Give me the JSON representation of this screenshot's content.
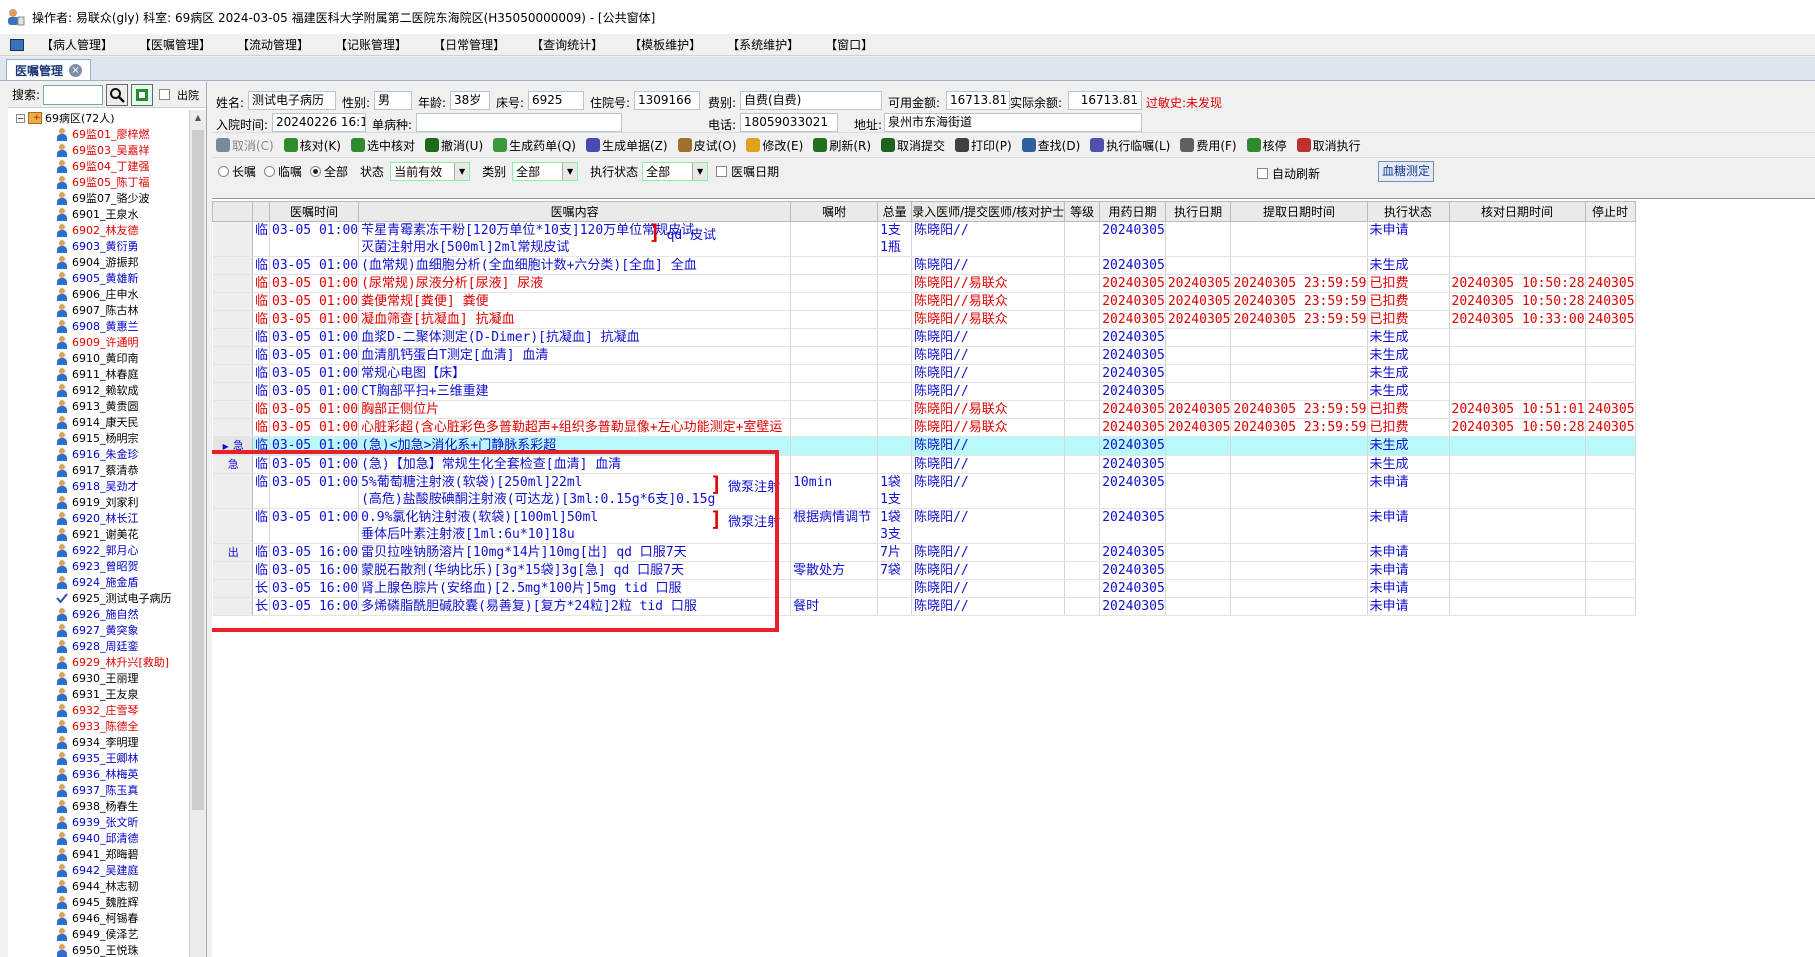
{
  "title_bar": {
    "text": "操作者: 易联众(gly)  科室: 69病区  2024-03-05  福建医科大学附属第二医院东海院区(H35050000009) - [公共窗体]"
  },
  "menu": [
    "【病人管理】",
    "【医嘱管理】",
    "【流动管理】",
    "【记账管理】",
    "【日常管理】",
    "【查询统计】",
    "【模板维护】",
    "【系统维护】",
    "【窗口】"
  ],
  "active_tab": "医嘱管理",
  "left_panel": {
    "search_label": "搜索:",
    "search_value": "",
    "discharge_label": "出院",
    "root": "69病区(72人)",
    "patients": [
      {
        "label": "69监01_廖梓燃",
        "color": "red"
      },
      {
        "label": "69监03_吴嘉祥",
        "color": "red"
      },
      {
        "label": "69监04_丁建强",
        "color": "red"
      },
      {
        "label": "69监05_陈丁福",
        "color": "red"
      },
      {
        "label": "69监07_骆少波",
        "color": "black"
      },
      {
        "label": "6901_王泉水",
        "color": "black"
      },
      {
        "label": "6902_林友德",
        "color": "red"
      },
      {
        "label": "6903_黄衍勇",
        "color": "blue"
      },
      {
        "label": "6904_游振邦",
        "color": "black"
      },
      {
        "label": "6905_黄雄新",
        "color": "blue"
      },
      {
        "label": "6906_庄申水",
        "color": "black"
      },
      {
        "label": "6907_陈古林",
        "color": "black"
      },
      {
        "label": "6908_黄惠兰",
        "color": "blue"
      },
      {
        "label": "6909_许通明",
        "color": "red"
      },
      {
        "label": "6910_黄印南",
        "color": "black"
      },
      {
        "label": "6911_林春庭",
        "color": "black"
      },
      {
        "label": "6912_赖软成",
        "color": "black"
      },
      {
        "label": "6913_黄贵圆",
        "color": "black"
      },
      {
        "label": "6914_康天民",
        "color": "black"
      },
      {
        "label": "6915_杨明宗",
        "color": "black"
      },
      {
        "label": "6916_朱金珍",
        "color": "blue"
      },
      {
        "label": "6917_蔡清恭",
        "color": "black"
      },
      {
        "label": "6918_吴劲才",
        "color": "blue"
      },
      {
        "label": "6919_刘家利",
        "color": "black"
      },
      {
        "label": "6920_林长江",
        "color": "blue"
      },
      {
        "label": "6921_谢美花",
        "color": "black"
      },
      {
        "label": "6922_郭月心",
        "color": "blue"
      },
      {
        "label": "6923_曾昭贺",
        "color": "blue"
      },
      {
        "label": "6924_施金盾",
        "color": "blue"
      },
      {
        "label": "6925_测试电子病历",
        "color": "black",
        "checked": true
      },
      {
        "label": "6926_施自然",
        "color": "blue"
      },
      {
        "label": "6927_黄突象",
        "color": "blue"
      },
      {
        "label": "6928_周廷銮",
        "color": "blue"
      },
      {
        "label": "6929_林升兴[救助]",
        "color": "red"
      },
      {
        "label": "6930_王丽理",
        "color": "black"
      },
      {
        "label": "6931_王友泉",
        "color": "black"
      },
      {
        "label": "6932_庄雪琴",
        "color": "red"
      },
      {
        "label": "6933_陈德全",
        "color": "red"
      },
      {
        "label": "6934_李明理",
        "color": "black"
      },
      {
        "label": "6935_王卿林",
        "color": "blue"
      },
      {
        "label": "6936_林梅英",
        "color": "blue"
      },
      {
        "label": "6937_陈玉真",
        "color": "blue"
      },
      {
        "label": "6938_杨春生",
        "color": "black"
      },
      {
        "label": "6939_张文昕",
        "color": "blue"
      },
      {
        "label": "6940_邱清德",
        "color": "blue"
      },
      {
        "label": "6941_郑晦碧",
        "color": "black"
      },
      {
        "label": "6942_吴建庭",
        "color": "blue"
      },
      {
        "label": "6944_林志韧",
        "color": "black"
      },
      {
        "label": "6945_魏胜辉",
        "color": "black"
      },
      {
        "label": "6946_柯锡春",
        "color": "black"
      },
      {
        "label": "6949_侯泽艺",
        "color": "black"
      },
      {
        "label": "6950_王悦珠",
        "color": "black"
      }
    ]
  },
  "patient_info": {
    "name_label": "姓名:",
    "name": "测试电子病历",
    "sex_label": "性别:",
    "sex": "男",
    "age_label": "年龄:",
    "age": "38岁",
    "bed_label": "床号:",
    "bed": "6925",
    "inpatient_label": "住院号:",
    "inpatient_no": "1309166",
    "category_label": "费别:",
    "category": "自费(自费)",
    "available_label": "可用金额:",
    "available": "16713.81",
    "balance_label": "实际余额:",
    "balance": "16713.81",
    "allergy": "过敏史:未发现",
    "admit_label": "入院时间:",
    "admit_time": "20240226 16:11:49",
    "disease_label": "单病种:",
    "disease": "",
    "phone_label": "电话:",
    "phone": "18059033021",
    "address_label": "地址:",
    "address": "泉州市东海街道"
  },
  "toolbar": [
    {
      "label": "取消(C)",
      "disabled": true,
      "color": "#7a8a9a"
    },
    {
      "label": "核对(K)",
      "disabled": false,
      "color": "#2e8b2e"
    },
    {
      "label": "选中核对",
      "disabled": false,
      "color": "#2e8b2e"
    },
    {
      "label": "撤消(U)",
      "disabled": false,
      "color": "#1a6a1a"
    },
    {
      "label": "生成药单(Q)",
      "disabled": false,
      "color": "#3a9a3a"
    },
    {
      "label": "生成单据(Z)",
      "disabled": false,
      "color": "#4a4ab0"
    },
    {
      "label": "皮试(O)",
      "disabled": false,
      "color": "#a07030"
    },
    {
      "label": "修改(E)",
      "disabled": false,
      "color": "#e0a020"
    },
    {
      "label": "刷新(R)",
      "disabled": false,
      "color": "#207020"
    },
    {
      "label": "取消提交",
      "disabled": false,
      "color": "#206020"
    },
    {
      "label": "打印(P)",
      "disabled": false,
      "color": "#404040"
    },
    {
      "label": "查找(D)",
      "disabled": false,
      "color": "#3060a0"
    },
    {
      "label": "执行临嘱(L)",
      "disabled": false,
      "color": "#5050b0"
    },
    {
      "label": "费用(F)",
      "disabled": false,
      "color": "#606060"
    },
    {
      "label": "核停",
      "disabled": false,
      "color": "#2e8b2e"
    },
    {
      "label": "取消执行",
      "disabled": false,
      "color": "#c03030"
    }
  ],
  "filters": {
    "long_label": "长嘱",
    "temp_label": "临嘱",
    "all_label": "全部",
    "status_label": "状态",
    "status_value": "当前有效",
    "type_label": "类别",
    "type_value": "全部",
    "exec_label": "执行状态",
    "exec_value": "全部",
    "date_label": "医嘱日期",
    "auto_refresh": "自动刷新",
    "glucose_btn": "血糖测定"
  },
  "grid": {
    "headers": [
      "",
      "",
      "医嘱时间",
      "医嘱内容",
      "嘱咐",
      "总量",
      "录入医师/提交医师/核对护士",
      "等级",
      "用药日期",
      "执行日期",
      "提取日期时间",
      "执行状态",
      "核对日期时间",
      "停止时"
    ],
    "rows": [
      {
        "tag": "",
        "type": "临",
        "time": "03-05 01:00",
        "content": [
          "苄星青霉素冻干粉[120万单位*10支]120万单位常规皮试",
          "灭菌注射用水[500ml]2ml常规皮试"
        ],
        "bracket": "qd 皮试",
        "note": "",
        "qty": [
          "1支",
          "1瓶"
        ],
        "doctor": "陈晓阳//",
        "level": "",
        "drug_date": "20240305",
        "exec_date": "",
        "extract": "",
        "status": "未申请",
        "check_time": "",
        "stop": "",
        "color": "blue"
      },
      {
        "tag": "",
        "type": "临",
        "time": "03-05 01:00",
        "content": [
          "(血常规)血细胞分析(全血细胞计数+六分类)[全血]   全血"
        ],
        "bracket": "",
        "note": "",
        "qty": [
          ""
        ],
        "doctor": "陈晓阳//",
        "level": "",
        "drug_date": "20240305",
        "exec_date": "",
        "extract": "",
        "status": "未生成",
        "check_time": "",
        "stop": "",
        "color": "blue"
      },
      {
        "tag": "",
        "type": "临",
        "time": "03-05 01:00",
        "content": [
          "(尿常规)尿液分析[尿液]   尿液"
        ],
        "bracket": "",
        "note": "",
        "qty": [
          ""
        ],
        "doctor": "陈晓阳//易联众",
        "level": "",
        "drug_date": "20240305",
        "exec_date": "20240305",
        "extract": "20240305 23:59:59",
        "status": "已扣费",
        "check_time": "20240305 10:50:28",
        "stop": "240305",
        "color": "red"
      },
      {
        "tag": "",
        "type": "临",
        "time": "03-05 01:00",
        "content": [
          "粪便常规[粪便]   粪便"
        ],
        "bracket": "",
        "note": "",
        "qty": [
          ""
        ],
        "doctor": "陈晓阳//易联众",
        "level": "",
        "drug_date": "20240305",
        "exec_date": "20240305",
        "extract": "20240305 23:59:59",
        "status": "已扣费",
        "check_time": "20240305 10:50:28",
        "stop": "240305",
        "color": "red"
      },
      {
        "tag": "",
        "type": "临",
        "time": "03-05 01:00",
        "content": [
          "凝血筛查[抗凝血]   抗凝血"
        ],
        "bracket": "",
        "note": "",
        "qty": [
          ""
        ],
        "doctor": "陈晓阳//易联众",
        "level": "",
        "drug_date": "20240305",
        "exec_date": "20240305",
        "extract": "20240305 23:59:59",
        "status": "已扣费",
        "check_time": "20240305 10:33:00",
        "stop": "240305",
        "color": "red"
      },
      {
        "tag": "",
        "type": "临",
        "time": "03-05 01:00",
        "content": [
          "血浆D-二聚体测定(D-Dimer)[抗凝血]   抗凝血"
        ],
        "bracket": "",
        "note": "",
        "qty": [
          ""
        ],
        "doctor": "陈晓阳//",
        "level": "",
        "drug_date": "20240305",
        "exec_date": "",
        "extract": "",
        "status": "未生成",
        "check_time": "",
        "stop": "",
        "color": "blue"
      },
      {
        "tag": "",
        "type": "临",
        "time": "03-05 01:00",
        "content": [
          "血清肌钙蛋白T测定[血清]   血清"
        ],
        "bracket": "",
        "note": "",
        "qty": [
          ""
        ],
        "doctor": "陈晓阳//",
        "level": "",
        "drug_date": "20240305",
        "exec_date": "",
        "extract": "",
        "status": "未生成",
        "check_time": "",
        "stop": "",
        "color": "blue"
      },
      {
        "tag": "",
        "type": "临",
        "time": "03-05 01:00",
        "content": [
          "常规心电图【床】"
        ],
        "bracket": "",
        "note": "",
        "qty": [
          ""
        ],
        "doctor": "陈晓阳//",
        "level": "",
        "drug_date": "20240305",
        "exec_date": "",
        "extract": "",
        "status": "未生成",
        "check_time": "",
        "stop": "",
        "color": "blue"
      },
      {
        "tag": "",
        "type": "临",
        "time": "03-05 01:00",
        "content": [
          "CT胸部平扫+三维重建"
        ],
        "bracket": "",
        "note": "",
        "qty": [
          ""
        ],
        "doctor": "陈晓阳//",
        "level": "",
        "drug_date": "20240305",
        "exec_date": "",
        "extract": "",
        "status": "未生成",
        "check_time": "",
        "stop": "",
        "color": "blue"
      },
      {
        "tag": "",
        "type": "临",
        "time": "03-05 01:00",
        "content": [
          "胸部正侧位片"
        ],
        "bracket": "",
        "note": "",
        "qty": [
          ""
        ],
        "doctor": "陈晓阳//易联众",
        "level": "",
        "drug_date": "20240305",
        "exec_date": "20240305",
        "extract": "20240305 23:59:59",
        "status": "已扣费",
        "check_time": "20240305 10:51:01",
        "stop": "240305",
        "color": "red"
      },
      {
        "tag": "",
        "type": "临",
        "time": "03-05 01:00",
        "content": [
          "心脏彩超(含心脏彩色多普勒超声+组织多普勒显像+左心功能测定+室壁运"
        ],
        "bracket": "",
        "note": "",
        "qty": [
          ""
        ],
        "doctor": "陈晓阳//易联众",
        "level": "",
        "drug_date": "20240305",
        "exec_date": "20240305",
        "extract": "20240305 23:59:59",
        "status": "已扣费",
        "check_time": "20240305 10:50:28",
        "stop": "240305",
        "color": "red"
      },
      {
        "tag": "急",
        "type": "临",
        "time": "03-05 01:00",
        "content": [
          "(急)<加急>消化系+门静脉系彩超"
        ],
        "bracket": "",
        "note": "",
        "qty": [
          ""
        ],
        "doctor": "陈晓阳//",
        "level": "",
        "drug_date": "20240305",
        "exec_date": "",
        "extract": "",
        "status": "未生成",
        "check_time": "",
        "stop": "",
        "color": "blue",
        "selected": true
      },
      {
        "tag": "急",
        "type": "临",
        "time": "03-05 01:00",
        "content": [
          "(急)【加急】常规生化全套检查[血清]   血清"
        ],
        "bracket": "",
        "note": "",
        "qty": [
          ""
        ],
        "doctor": "陈晓阳//",
        "level": "",
        "drug_date": "20240305",
        "exec_date": "",
        "extract": "",
        "status": "未生成",
        "check_time": "",
        "stop": "",
        "color": "blue"
      },
      {
        "tag": "",
        "type": "临",
        "time": "03-05 01:00",
        "content": [
          "5%葡萄糖注射液(软袋)[250ml]22ml",
          "(高危)盐酸胺碘酮注射液(可达龙)[3ml:0.15g*6支]0.15g"
        ],
        "bracket": "微泵注射",
        "note": "10min",
        "qty": [
          "1袋",
          "1支"
        ],
        "doctor": "陈晓阳//",
        "level": "",
        "drug_date": "20240305",
        "exec_date": "",
        "extract": "",
        "status": "未申请",
        "check_time": "",
        "stop": "",
        "color": "blue"
      },
      {
        "tag": "",
        "type": "临",
        "time": "03-05 01:00",
        "content": [
          "0.9%氯化钠注射液(软袋)[100ml]50ml",
          "垂体后叶素注射液[1ml:6u*10]18u"
        ],
        "bracket": "微泵注射",
        "note": "根据病情调节",
        "qty": [
          "1袋",
          "3支"
        ],
        "doctor": "陈晓阳//",
        "level": "",
        "drug_date": "20240305",
        "exec_date": "",
        "extract": "",
        "status": "未申请",
        "check_time": "",
        "stop": "",
        "color": "blue"
      },
      {
        "tag": "出",
        "type": "临",
        "time": "03-05 16:00",
        "content": [
          "雷贝拉唑钠肠溶片[10mg*14片]10mg[出]  qd 口服7天"
        ],
        "bracket": "",
        "note": "",
        "qty": [
          "7片"
        ],
        "doctor": "陈晓阳//",
        "level": "",
        "drug_date": "20240305",
        "exec_date": "",
        "extract": "",
        "status": "未申请",
        "check_time": "",
        "stop": "",
        "color": "blue"
      },
      {
        "tag": "",
        "type": "临",
        "time": "03-05 16:00",
        "content": [
          "蒙脱石散剂(华纳比乐)[3g*15袋]3g[急]  qd 口服7天"
        ],
        "bracket": "",
        "note": "零散处方",
        "qty": [
          "7袋"
        ],
        "doctor": "陈晓阳//",
        "level": "",
        "drug_date": "20240305",
        "exec_date": "",
        "extract": "",
        "status": "未申请",
        "check_time": "",
        "stop": "",
        "color": "blue"
      },
      {
        "tag": "",
        "type": "长",
        "time": "03-05 16:00",
        "content": [
          "肾上腺色腙片(安络血)[2.5mg*100片]5mg  tid 口服"
        ],
        "bracket": "",
        "note": "",
        "qty": [
          ""
        ],
        "doctor": "陈晓阳//",
        "level": "",
        "drug_date": "20240305",
        "exec_date": "",
        "extract": "",
        "status": "未申请",
        "check_time": "",
        "stop": "",
        "color": "blue"
      },
      {
        "tag": "",
        "type": "长",
        "time": "03-05 16:00",
        "content": [
          "多烯磷脂酰胆碱胶囊(易善复)[复方*24粒]2粒  tid 口服"
        ],
        "bracket": "",
        "note": "餐时",
        "qty": [
          ""
        ],
        "doctor": "陈晓阳//",
        "level": "",
        "drug_date": "20240305",
        "exec_date": "",
        "extract": "",
        "status": "未申请",
        "check_time": "",
        "stop": "",
        "color": "blue"
      }
    ]
  }
}
